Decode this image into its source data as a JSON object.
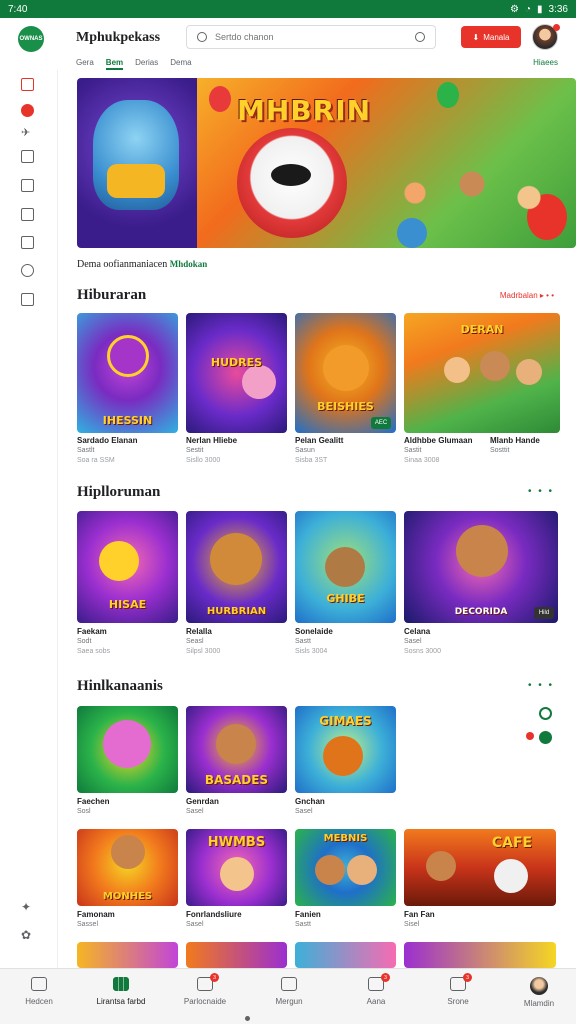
{
  "status_bar": {
    "time": "7:40",
    "battery": "3:36"
  },
  "header": {
    "logo_text": "OWNAS",
    "app_title": "Mphukpekass",
    "search_placeholder": "Sertdo chanon",
    "cta_label": "Manala"
  },
  "subtabs": {
    "items": [
      "Gera",
      "Bem",
      "Derias",
      "Dema"
    ],
    "right_link": "Hiaees"
  },
  "hero": {
    "title": "MHBRIN"
  },
  "section_intro": {
    "text": "Dema oofianmaniacen",
    "green": "Mhdokan"
  },
  "sections": [
    {
      "title": "Hiburaran",
      "more": "Madrbalan",
      "cards": [
        {
          "title": "Sardado Elanan",
          "sub": "Sastlt",
          "sub2": "Soa ra SSM",
          "art": "IHESSIN"
        },
        {
          "title": "Nerlan Hliebe",
          "sub": "Sestit",
          "sub2": "Sisllo 3000",
          "art": "HUDRES"
        },
        {
          "title": "Pelan Gealitt",
          "sub": "Sasun",
          "sub2": "Sisba 3ST",
          "art": "BEISHIES",
          "badge": "AEC"
        },
        {
          "title": "Aldhbbe Glumaan",
          "sub": "Sastit",
          "sub2": "Sinaa 3008",
          "art": "DERAN"
        },
        {
          "title": "Mlanb Hande",
          "sub": "Sosttit",
          "sub2": "",
          "art": ""
        }
      ]
    },
    {
      "title": "Hiplloruman",
      "more": "",
      "cards": [
        {
          "title": "Faekam",
          "sub": "Sodt",
          "sub2": "Saea sobs",
          "art": "HISAE"
        },
        {
          "title": "Relalla",
          "sub": "Seasl",
          "sub2": "Silpsl 3000",
          "art": "HURBRIAN"
        },
        {
          "title": "Sonelaide",
          "sub": "Sastt",
          "sub2": "Sisls 3004",
          "art": "GHIBE"
        },
        {
          "title": "Celana",
          "sub": "Sasel",
          "sub2": "Sosns 3000",
          "art": "DECORIDA",
          "badge": "Hild"
        }
      ]
    },
    {
      "title": "Hinlkanaanis",
      "more": "",
      "cards": [
        {
          "title": "Faechen",
          "sub": "Sosl",
          "sub2": "",
          "art": ""
        },
        {
          "title": "Genrdan",
          "sub": "Sasel",
          "sub2": "",
          "art": "BASADES"
        },
        {
          "title": "Gnchan",
          "sub": "Sasel",
          "sub2": "",
          "art": "GIMAES"
        },
        {
          "title": "Famonam",
          "sub": "Sassel",
          "sub2": "",
          "art": "MONHES"
        },
        {
          "title": "Fonrlandsliure",
          "sub": "Sasel",
          "sub2": "",
          "art": "HWMBS"
        },
        {
          "title": "Fanien",
          "sub": "Sastt",
          "sub2": "",
          "art": "MEBNIS"
        },
        {
          "title": "Fan Fan",
          "sub": "Sisel",
          "sub2": "",
          "art": "CAFE"
        }
      ]
    }
  ],
  "bottom_nav": [
    {
      "label": "Hedcen",
      "badge": ""
    },
    {
      "label": "Lirantsa farbd",
      "badge": ""
    },
    {
      "label": "Parlocnaide",
      "badge": "3"
    },
    {
      "label": "Mergun",
      "badge": ""
    },
    {
      "label": "Aana",
      "badge": "3"
    },
    {
      "label": "Srone",
      "badge": "3"
    },
    {
      "label": "Mlamdin",
      "badge": ""
    }
  ],
  "colors": {
    "brand_green": "#0f7a3c",
    "accent_red": "#e8332a"
  }
}
